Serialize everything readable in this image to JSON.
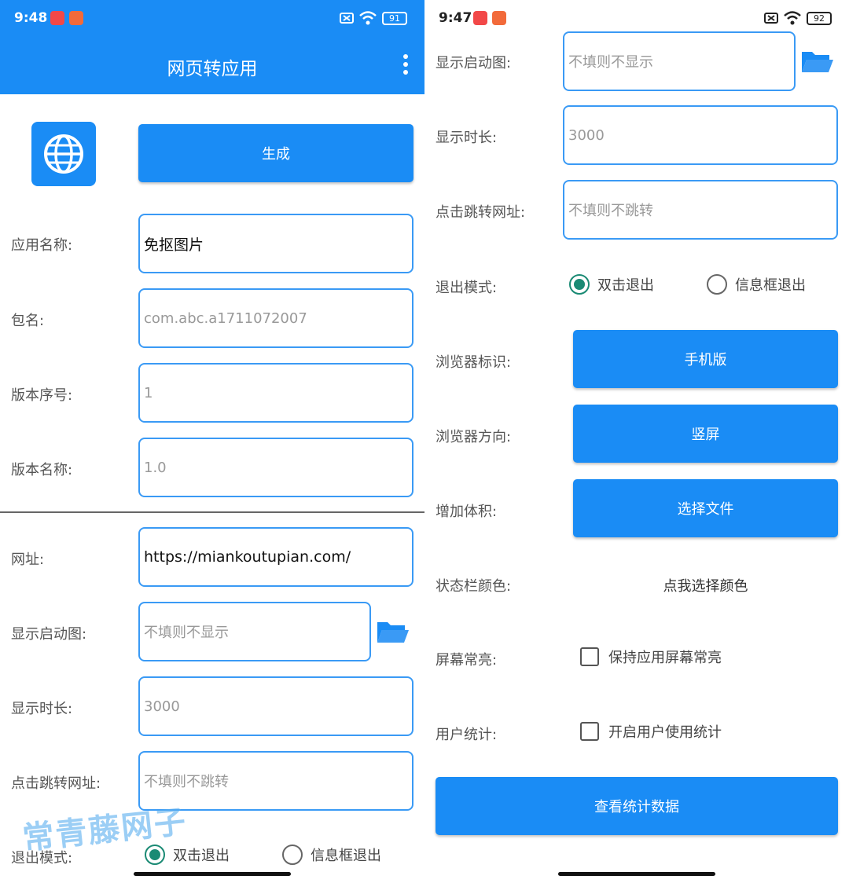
{
  "left": {
    "status": {
      "time": "9:48",
      "battery": "91"
    },
    "toolbar": {
      "title": "网页转应用"
    },
    "generate_label": "生成",
    "fields": {
      "app_name": {
        "label": "应用名称:",
        "value": "免抠图片"
      },
      "package": {
        "label": "包名:",
        "placeholder": "com.abc.a1711072007"
      },
      "version_code": {
        "label": "版本序号:",
        "placeholder": "1"
      },
      "version_name": {
        "label": "版本名称:",
        "placeholder": "1.0"
      },
      "url": {
        "label": "网址:",
        "value": "https://miankoutupian.com/"
      },
      "splash": {
        "label": "显示启动图:",
        "placeholder": "不填则不显示"
      },
      "duration": {
        "label": "显示时长:",
        "placeholder": "3000"
      },
      "click_url": {
        "label": "点击跳转网址:",
        "placeholder": "不填则不跳转"
      }
    },
    "exit_mode": {
      "label": "退出模式:",
      "option1": "双击退出",
      "option2": "信息框退出"
    },
    "watermark": "常青藤网子"
  },
  "right": {
    "status": {
      "time": "9:47",
      "battery": "92"
    },
    "fields": {
      "splash": {
        "label": "显示启动图:",
        "placeholder": "不填则不显示"
      },
      "duration": {
        "label": "显示时长:",
        "placeholder": "3000"
      },
      "click_url": {
        "label": "点击跳转网址:",
        "placeholder": "不填则不跳转"
      }
    },
    "exit_mode": {
      "label": "退出模式:",
      "option1": "双击退出",
      "option2": "信息框退出"
    },
    "browser_ua": {
      "label": "浏览器标识:",
      "button": "手机版"
    },
    "browser_orientation": {
      "label": "浏览器方向:",
      "button": "竖屏"
    },
    "add_size": {
      "label": "增加体积:",
      "button": "选择文件"
    },
    "statusbar_color": {
      "label": "状态栏颜色:",
      "link": "点我选择颜色"
    },
    "screen_on": {
      "label": "屏幕常亮:",
      "checkbox": "保持应用屏幕常亮"
    },
    "user_stats": {
      "label": "用户统计:",
      "checkbox": "开启用户使用统计"
    },
    "view_stats_button": "查看统计数据"
  },
  "colors": {
    "primary": "#1a8cf5",
    "field_border": "#3a9af5",
    "radio_checked": "#1a8a74"
  }
}
